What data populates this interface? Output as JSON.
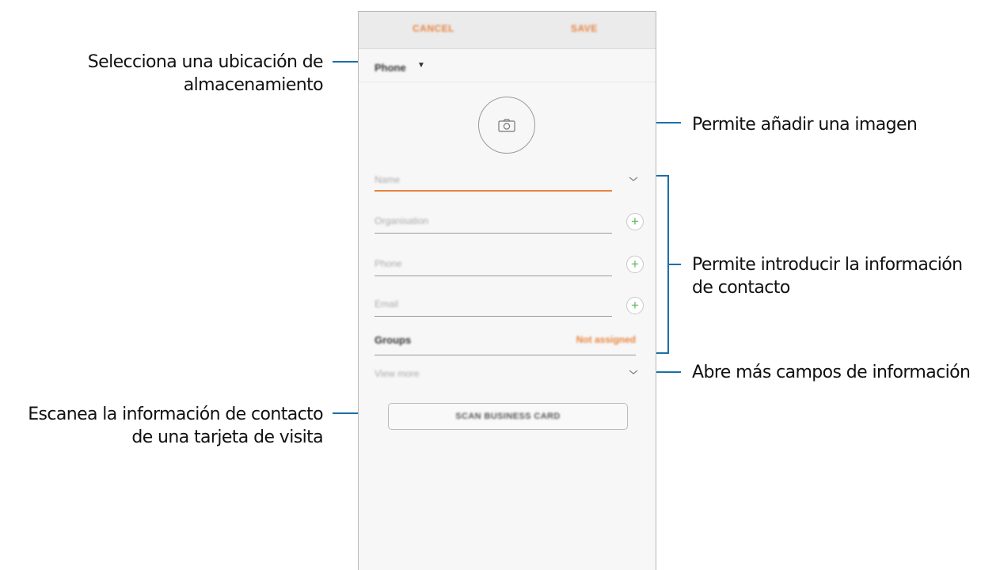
{
  "topbar": {
    "cancel_label": "CANCEL",
    "save_label": "SAVE"
  },
  "storage": {
    "label": "Phone"
  },
  "fields": {
    "name_placeholder": "Name",
    "organisation_placeholder": "Organisation",
    "phone_placeholder": "Phone",
    "email_placeholder": "Email"
  },
  "groups": {
    "label": "Groups",
    "value": "Not assigned"
  },
  "view_more_label": "View more",
  "scan_button_label": "SCAN BUSINESS CARD",
  "annotations": {
    "storage_line1": "Selecciona una ubicación de",
    "storage_line2": "almacenamiento",
    "image": "Permite añadir una imagen",
    "contact_line1": "Permite introducir la información",
    "contact_line2": "de contacto",
    "more": "Abre más campos de información",
    "scan_line1": "Escanea la información de contacto",
    "scan_line2": "de una tarjeta de visita"
  },
  "colors": {
    "accent": "#e8843f",
    "plus_green": "#5bb35b",
    "callout_blue": "#1b6fa8"
  },
  "icons": [
    "camera-icon",
    "caret-down-icon",
    "chevron-down-icon",
    "plus-icon"
  ]
}
